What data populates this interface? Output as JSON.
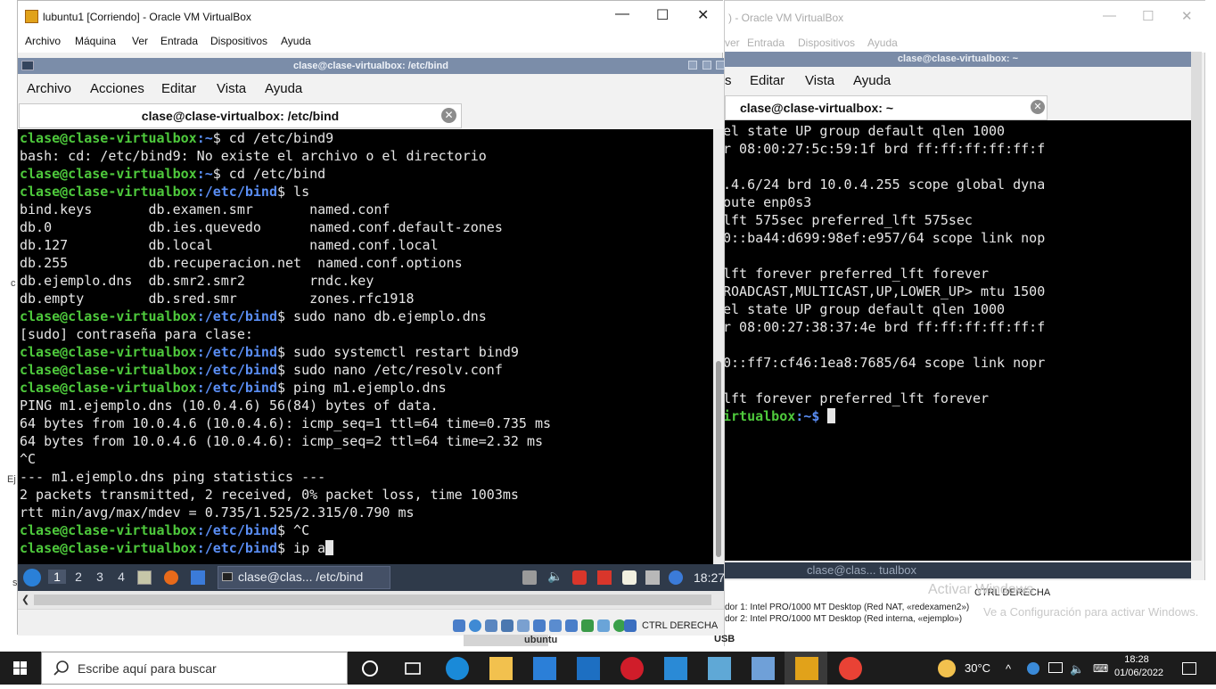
{
  "background_window": {
    "title": ") - Oracle VM VirtualBox",
    "menu": [
      "ver",
      "Entrada",
      "Dispositivos",
      "Ayuda"
    ],
    "lxde_title": "clase@clase-virtualbox: ~",
    "lxde_menu": [
      "s",
      "Editar",
      "Vista",
      "Ayuda"
    ],
    "tab_label": "clase@clase-virtualbox: ~",
    "terminal_lines": [
      "el state UP group default qlen 1000",
      "r 08:00:27:5c:59:1f brd ff:ff:ff:ff:ff:f",
      "",
      ".4.6/24 brd 10.0.4.255 scope global dyna",
      "oute enp0s3",
      "lft 575sec preferred_lft 575sec",
      "0::ba44:d699:98ef:e957/64 scope link nop",
      "",
      "lft forever preferred_lft forever",
      "ROADCAST,MULTICAST,UP,LOWER_UP> mtu 1500",
      "el state UP group default qlen 1000",
      "r 08:00:27:38:37:4e brd ff:ff:ff:ff:ff:f",
      "",
      "0::ff7:cf46:1ea8:7685/64 scope link nopr",
      "",
      "lft forever preferred_lft forever"
    ],
    "prompt_host": "irtualbox",
    "prompt_path": ":~$ ",
    "panel_task": "clase@clas... tualbox",
    "hostkey": "CTRL DERECHA",
    "adapter1": "dor 1:   Intel PRO/1000 MT Desktop (Red NAT, «redexamen2»)",
    "adapter2": "dor 2:   Intel PRO/1000 MT Desktop (Red interna, «ejemplo»)",
    "usb": "USB",
    "watermark": "Activar Windows",
    "watermark2": "Ve a Configuración para activar Windows."
  },
  "main_window": {
    "title": "lubuntu1 [Corriendo] - Oracle VM VirtualBox",
    "menu": [
      "Archivo",
      "Máquina",
      "Ver",
      "Entrada",
      "Dispositivos",
      "Ayuda"
    ],
    "lxde_title": "clase@clase-virtualbox: /etc/bind",
    "lxde_menu": [
      "Archivo",
      "Acciones",
      "Editar",
      "Vista",
      "Ayuda"
    ],
    "tab_label": "clase@clase-virtualbox: /etc/bind",
    "prompt_user": "clase@clase-virtualbox",
    "terminal": [
      {
        "path": ":~",
        "cmd": "$ cd /etc/bind9"
      },
      {
        "out": "bash: cd: /etc/bind9: No existe el archivo o el directorio"
      },
      {
        "path": ":~",
        "cmd": "$ cd /etc/bind"
      },
      {
        "path": ":/etc/bind",
        "cmd": "$ ls"
      },
      {
        "out": "bind.keys       db.examen.smr       named.conf"
      },
      {
        "out": "db.0            db.ies.quevedo      named.conf.default-zones"
      },
      {
        "out": "db.127          db.local            named.conf.local"
      },
      {
        "out": "db.255          db.recuperacion.net  named.conf.options"
      },
      {
        "out": "db.ejemplo.dns  db.smr2.smr2        rndc.key"
      },
      {
        "out": "db.empty        db.sred.smr         zones.rfc1918"
      },
      {
        "path": ":/etc/bind",
        "cmd": "$ sudo nano db.ejemplo.dns"
      },
      {
        "out": "[sudo] contraseña para clase:"
      },
      {
        "path": ":/etc/bind",
        "cmd": "$ sudo systemctl restart bind9"
      },
      {
        "path": ":/etc/bind",
        "cmd": "$ sudo nano /etc/resolv.conf"
      },
      {
        "path": ":/etc/bind",
        "cmd": "$ ping m1.ejemplo.dns"
      },
      {
        "out": "PING m1.ejemplo.dns (10.0.4.6) 56(84) bytes of data."
      },
      {
        "out": "64 bytes from 10.0.4.6 (10.0.4.6): icmp_seq=1 ttl=64 time=0.735 ms"
      },
      {
        "out": "64 bytes from 10.0.4.6 (10.0.4.6): icmp_seq=2 ttl=64 time=2.32 ms"
      },
      {
        "out": "^C"
      },
      {
        "out": "--- m1.ejemplo.dns ping statistics ---"
      },
      {
        "out": "2 packets transmitted, 2 received, 0% packet loss, time 1003ms"
      },
      {
        "out": "rtt min/avg/max/mdev = 0.735/1.525/2.315/0.790 ms"
      },
      {
        "path": ":/etc/bind",
        "cmd": "$ ^C"
      },
      {
        "path": ":/etc/bind",
        "cmd": "$ ip a",
        "cursor": true
      }
    ],
    "panel": {
      "workspaces": [
        "1",
        "2",
        "3",
        "4"
      ],
      "task_label": "clase@clas... /etc/bind",
      "clock": "18:27"
    },
    "hostkey": "CTRL DERECHA",
    "behind_label": "ubuntu"
  },
  "taskbar": {
    "search_placeholder": "Escribe aquí para buscar",
    "temperature": "30°C",
    "time": "18:28",
    "date": "01/06/2022"
  },
  "desktop_fragments": [
    "c",
    "Ej",
    "s"
  ]
}
